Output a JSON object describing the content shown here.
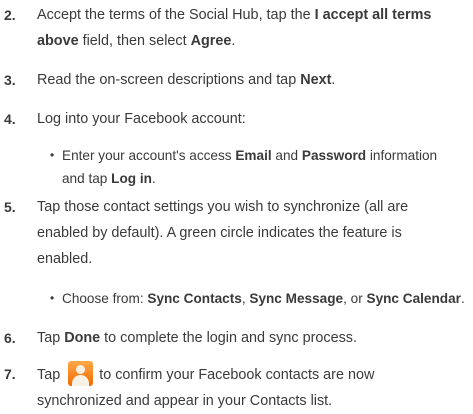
{
  "steps": [
    {
      "num": "2.",
      "t1": "Accept the terms of the Social Hub, tap the ",
      "b1": "I accept all terms",
      "t2": "above",
      "t3": " field, then select ",
      "b2": "Agree",
      "t4": "."
    },
    {
      "num": "3.",
      "t1": "Read the on-screen descriptions and tap ",
      "b1": "Next",
      "t2": "."
    },
    {
      "num": "4.",
      "t1": "Log into your Facebook account:"
    },
    {
      "bullet": "•",
      "t1": "Enter your account's access ",
      "b1": "Email",
      "t2": " and ",
      "b2": "Password",
      "t3": " information",
      "t4": "and tap ",
      "b3": "Log in",
      "t5": "."
    },
    {
      "num": "5.",
      "t1": "Tap those contact settings you wish to synchronize (all are",
      "t2": "enabled by default). A green circle indicates the feature is",
      "t3": "enabled."
    },
    {
      "bullet": "•",
      "t1": "Choose from: ",
      "b1": "Sync Contacts",
      "t2": ", ",
      "b2": "Sync Message",
      "t3": ", or ",
      "b3": "Sync Calendar",
      "t4": "."
    },
    {
      "num": "6.",
      "t1": "Tap ",
      "b1": "Done",
      "t2": " to complete the login and sync process."
    },
    {
      "num": "7.",
      "t1": "Tap",
      "icon": "contacts-app-icon",
      "t2": "to confirm your Facebook contacts are now",
      "t3": "synchronized and appear in your Contacts list."
    }
  ]
}
